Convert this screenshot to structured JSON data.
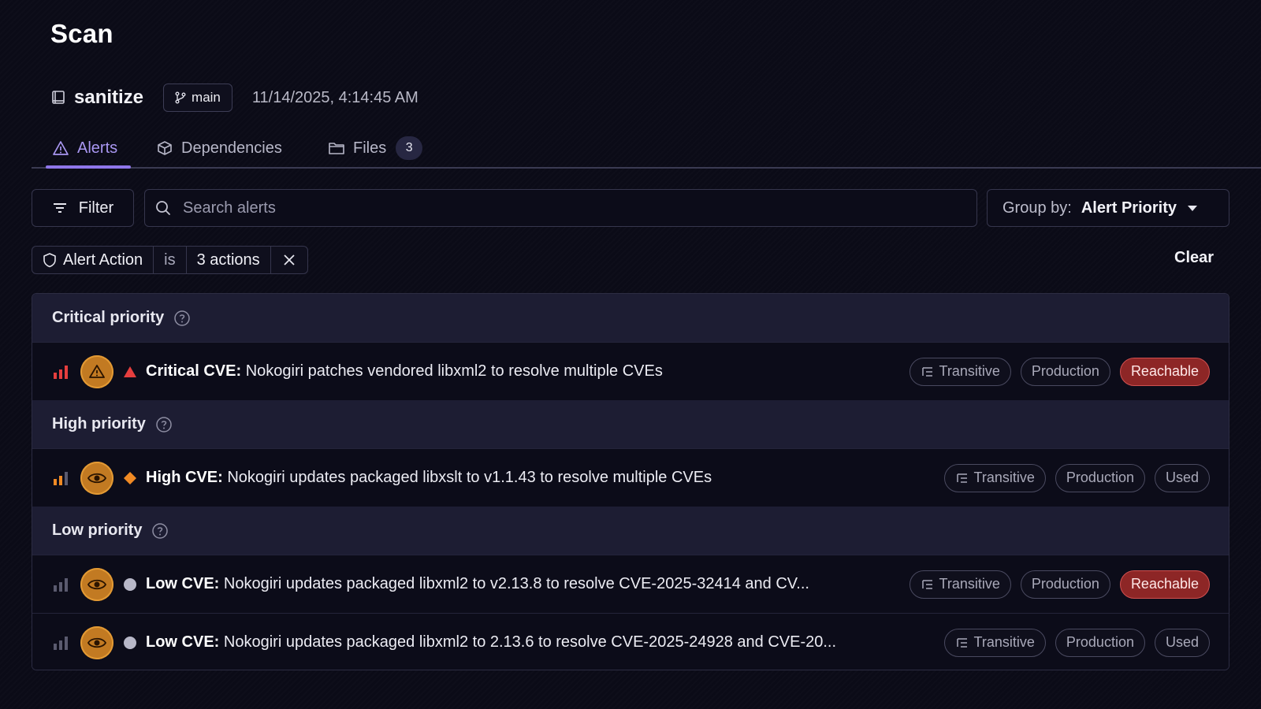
{
  "page": {
    "title": "Scan"
  },
  "repo": {
    "name": "sanitize",
    "branch": "main",
    "scan_time": "11/14/2025, 4:14:45 AM"
  },
  "tabs": [
    {
      "label": "Alerts",
      "icon": "warning-triangle-icon",
      "active": true
    },
    {
      "label": "Dependencies",
      "icon": "package-icon",
      "active": false
    },
    {
      "label": "Files",
      "icon": "folder-icon",
      "active": false,
      "count": "3"
    }
  ],
  "toolbar": {
    "filter_label": "Filter",
    "search_placeholder": "Search alerts",
    "group_by_label": "Group by:",
    "group_by_value": "Alert Priority"
  },
  "active_filter": {
    "field": "Alert Action",
    "operator": "is",
    "value": "3 actions",
    "clear_label": "Clear"
  },
  "groups": [
    {
      "title": "Critical priority",
      "alerts": [
        {
          "severity": "Critical CVE:",
          "text": "Nokogiri patches vendored libxml2 to resolve multiple CVEs",
          "tags": [
            "Transitive",
            "Production",
            "Reachable"
          ]
        }
      ]
    },
    {
      "title": "High priority",
      "alerts": [
        {
          "severity": "High CVE:",
          "text": "Nokogiri updates packaged libxslt to v1.1.43 to resolve multiple CVEs",
          "tags": [
            "Transitive",
            "Production",
            "Used"
          ]
        }
      ]
    },
    {
      "title": "Low priority",
      "alerts": [
        {
          "severity": "Low CVE:",
          "text": "Nokogiri updates packaged libxml2 to v2.13.8 to resolve CVE-2025-32414 and CV...",
          "tags": [
            "Transitive",
            "Production",
            "Reachable"
          ]
        },
        {
          "severity": "Low CVE:",
          "text": "Nokogiri updates packaged libxml2 to 2.13.6 to resolve CVE-2025-24928 and CVE-20...",
          "tags": [
            "Transitive",
            "Production",
            "Used"
          ]
        }
      ]
    }
  ],
  "colors": {
    "accent": "#8f76ea",
    "critical": "#e53e3e",
    "high": "#f08a24",
    "low": "#b8b8c8",
    "reachable": "#8d2626"
  }
}
